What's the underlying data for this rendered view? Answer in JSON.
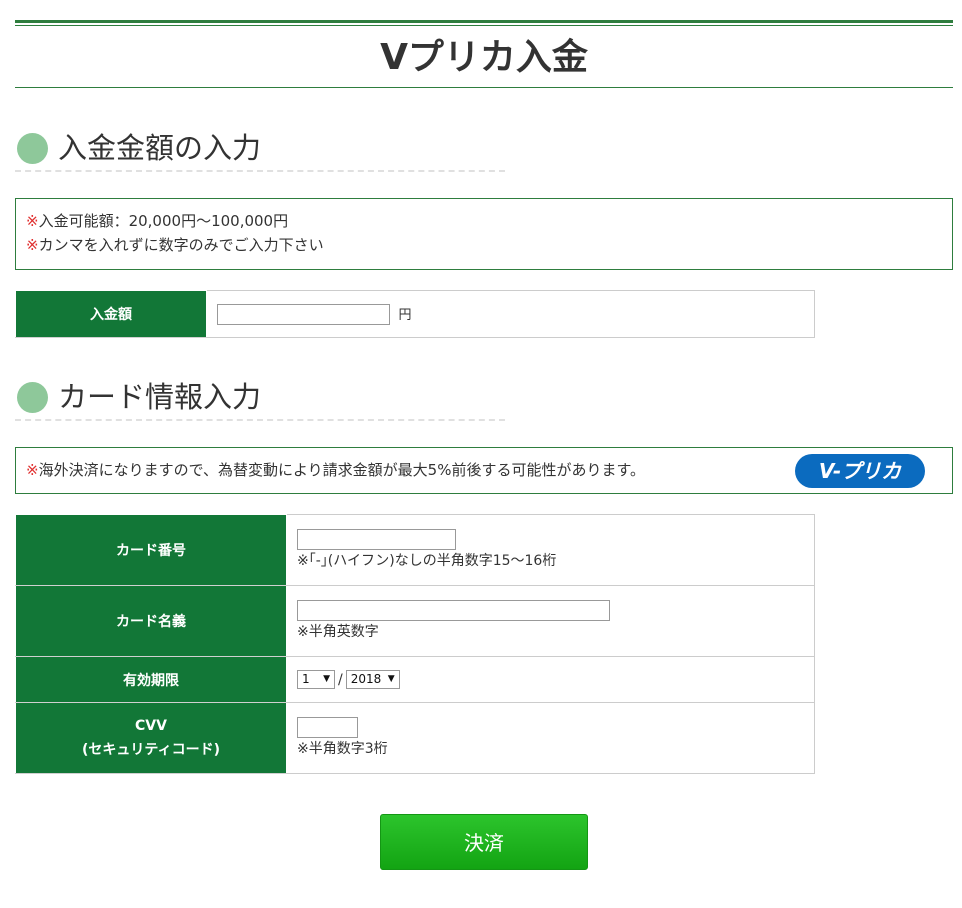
{
  "page": {
    "title": "Vプリカ入金"
  },
  "section_amount": {
    "heading": "入金金額の入力",
    "notice": [
      {
        "mark": "※",
        "text": "入金可能額：20,000円～100,000円"
      },
      {
        "mark": "※",
        "text": "カンマを入れずに数字のみでご入力下さい"
      }
    ],
    "amount_label": "入金額",
    "amount_value": "",
    "amount_unit": "円"
  },
  "section_card": {
    "heading": "カード情報入力",
    "notice": {
      "mark": "※",
      "text": "海外決済になりますので、為替変動により請求金額が最大5%前後する可能性があります。"
    },
    "logo_text": "V-プリカ",
    "card_number": {
      "label": "カード番号",
      "value": "",
      "hint": "※｢-｣(ハイフン)なしの半角数字15～16桁"
    },
    "card_name": {
      "label": "カード名義",
      "value": "",
      "hint": "※半角英数字"
    },
    "expiry": {
      "label": "有効期限",
      "month": "1",
      "separator": "/",
      "year": "2018"
    },
    "cvv": {
      "label_line1": "CVV",
      "label_line2": "(セキュリティコード)",
      "value": "",
      "hint": "※半角数字3桁"
    }
  },
  "submit": {
    "label": "決済"
  },
  "colors": {
    "primary_green": "#127737",
    "accent_dot": "#8ec89a",
    "button_green": "#1fb31f",
    "warning_red": "#e03030",
    "logo_blue": "#0b6bbf"
  }
}
